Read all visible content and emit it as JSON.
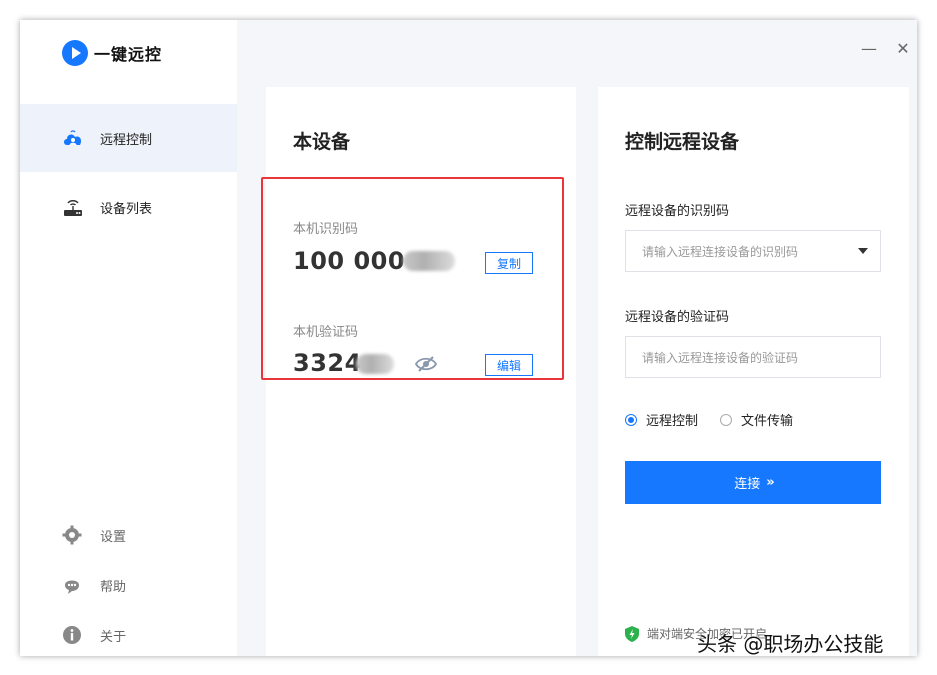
{
  "app": {
    "title": "一键远控"
  },
  "sidebar": {
    "items": [
      {
        "label": "远程控制",
        "icon": "cloud-user-icon",
        "active": true
      },
      {
        "label": "设备列表",
        "icon": "router-icon",
        "active": false
      }
    ],
    "bottom": [
      {
        "label": "设置",
        "icon": "gear-icon"
      },
      {
        "label": "帮助",
        "icon": "help-chat-icon"
      },
      {
        "label": "关于",
        "icon": "info-icon"
      }
    ]
  },
  "window_controls": {
    "minimize": "—",
    "close": "✕"
  },
  "device": {
    "title": "本设备",
    "id_label": "本机识别码",
    "id_value": "100 000",
    "copy_label": "复制",
    "code_label": "本机验证码",
    "code_value": "3324",
    "edit_label": "编辑"
  },
  "remote": {
    "title": "控制远程设备",
    "id_label": "远程设备的识别码",
    "id_placeholder": "请输入远程连接设备的识别码",
    "code_label": "远程设备的验证码",
    "code_placeholder": "请输入远程连接设备的验证码",
    "modes": [
      {
        "label": "远程控制",
        "checked": true
      },
      {
        "label": "文件传输",
        "checked": false
      }
    ],
    "connect_label": "连接",
    "connect_chevron": "»",
    "secure_text": "端对端安全加密已开启"
  },
  "watermark": "头条 @职场办公技能",
  "colors": {
    "accent": "#1677ff",
    "highlight": "#e8363b",
    "secure": "#2bb24c"
  }
}
